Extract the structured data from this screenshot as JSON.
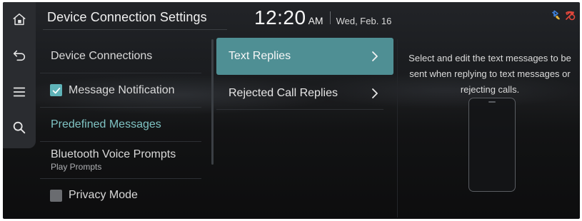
{
  "header": {
    "title": "Device Connection Settings",
    "time": "12:20",
    "ampm": "AM",
    "date": "Wed, Feb. 16"
  },
  "rail": {
    "icons": [
      "home-icon",
      "back-icon",
      "menu-icon",
      "search-icon"
    ]
  },
  "status_icons": [
    "bluetooth-phone-icon",
    "phone-disconnected-icon"
  ],
  "colors": {
    "accent": "#5fb3b8",
    "active_item": "#4f8f94",
    "section_header": "#7fc3c3",
    "status_red": "#e0463b",
    "status_blue": "#3f7fd8"
  },
  "menu": {
    "items": [
      {
        "label": "Device Connections"
      },
      {
        "label": "Message Notification",
        "checked": true
      },
      {
        "label": "Predefined Messages"
      },
      {
        "label": "Bluetooth Voice Prompts",
        "sub": "Play Prompts"
      },
      {
        "label": "Privacy Mode",
        "checked": false
      }
    ]
  },
  "sublist": {
    "items": [
      {
        "label": "Text Replies",
        "selected": true
      },
      {
        "label": "Rejected Call Replies",
        "selected": false
      }
    ]
  },
  "description": "Select and edit the text messages to be sent when replying to text messages or rejecting calls."
}
